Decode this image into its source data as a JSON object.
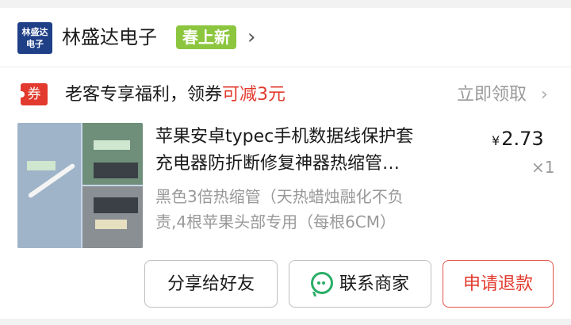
{
  "shop": {
    "logo_line1": "林盛达",
    "logo_line2": "电子",
    "name": "林盛达电子",
    "badge": "春上新",
    "chevron": "›"
  },
  "coupon": {
    "tag": "券",
    "text_prefix": "老客专享福利，领券",
    "text_highlight": "可减3元",
    "claim_label": "立即领取",
    "claim_chevron": "›"
  },
  "product": {
    "title_line1": "苹果安卓typec手机数据线保护套",
    "title_line2": "充电器防折断修复神器热缩管…",
    "spec_line1": "黑色3倍热缩管（天热蜡烛融化不负",
    "spec_line2": "责,4根苹果头部专用（每根6CM）",
    "currency": "¥",
    "price": "2.73",
    "quantity": "×1"
  },
  "actions": {
    "share_label": "分享给好友",
    "contact_label": "联系商家",
    "refund_label": "申请退款"
  },
  "colors": {
    "accent_red": "#e23a2e",
    "badge_green": "#8cc63f",
    "wechat_green": "#2aae67",
    "logo_blue": "#1f3f86"
  }
}
